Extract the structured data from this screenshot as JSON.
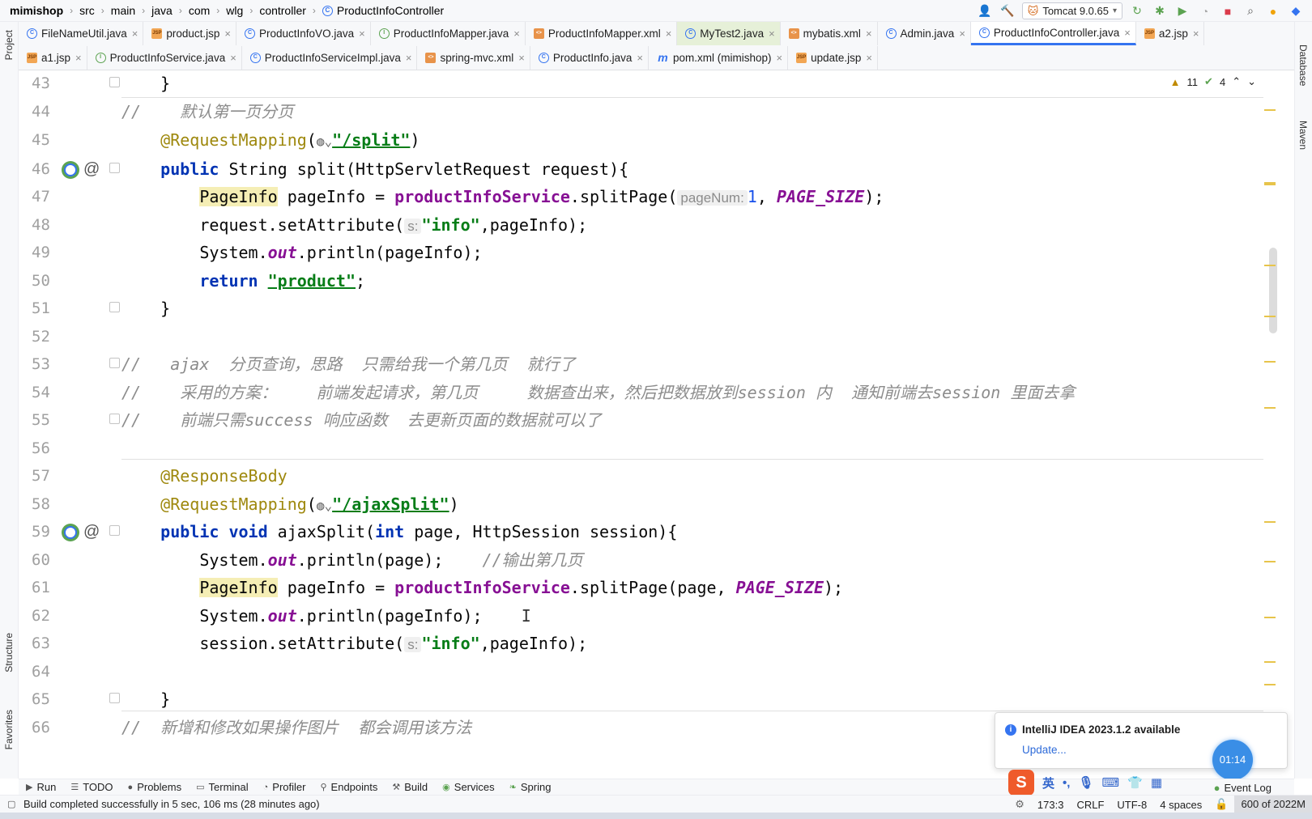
{
  "breadcrumb": [
    "mimishop",
    "src",
    "main",
    "java",
    "com",
    "wlg",
    "controller",
    "ProductInfoController"
  ],
  "run_config": "Tomcat 9.0.65",
  "tabs_row1": [
    {
      "name": "FileNameUtil.java",
      "icon": "c"
    },
    {
      "name": "product.jsp",
      "icon": "jsp"
    },
    {
      "name": "ProductInfoVO.java",
      "icon": "c"
    },
    {
      "name": "ProductInfoMapper.java",
      "icon": "i"
    },
    {
      "name": "ProductInfoMapper.xml",
      "icon": "xml"
    },
    {
      "name": "MyTest2.java",
      "icon": "c"
    },
    {
      "name": "mybatis.xml",
      "icon": "xml"
    },
    {
      "name": "Admin.java",
      "icon": "c"
    },
    {
      "name": "ProductInfoController.java",
      "icon": "c"
    },
    {
      "name": "a2.jsp",
      "icon": "jsp"
    }
  ],
  "tabs_row2": [
    {
      "name": "a1.jsp",
      "icon": "jsp"
    },
    {
      "name": "ProductInfoService.java",
      "icon": "i"
    },
    {
      "name": "ProductInfoServiceImpl.java",
      "icon": "c"
    },
    {
      "name": "spring-mvc.xml",
      "icon": "xml"
    },
    {
      "name": "ProductInfo.java",
      "icon": "c"
    },
    {
      "name": "pom.xml (mimishop)",
      "icon": "m"
    },
    {
      "name": "update.jsp",
      "icon": "jsp"
    }
  ],
  "side_tabs": {
    "project": "Project",
    "structure": "Structure",
    "favorites": "Favorites",
    "database": "Database",
    "maven": "Maven"
  },
  "inspections": {
    "warnings": "11",
    "ok": "4"
  },
  "code": {
    "l43": {
      "num": "43",
      "brace": "}"
    },
    "l44": {
      "num": "44",
      "comment": "//    默认第一页分页"
    },
    "l45": {
      "num": "45",
      "ann": "@RequestMapping",
      "path": "\"/split\""
    },
    "l46": {
      "num": "46",
      "kw": "public",
      "rest": " String split(HttpServletRequest request){"
    },
    "l47": {
      "num": "47",
      "type": "PageInfo",
      "mid": " pageInfo = ",
      "svc": "productInfoService",
      "call": ".splitPage(",
      "hint": "pageNum:",
      "n": "1",
      "sep": ", ",
      "fld": "PAGE_SIZE",
      "end": ");"
    },
    "l48": {
      "num": "48",
      "pre": "request.setAttribute(",
      "hint": "s:",
      "str": "\"info\"",
      "end": ",pageInfo);"
    },
    "l49": {
      "num": "49",
      "pre": "System.",
      "fld": "out",
      "end": ".println(pageInfo);"
    },
    "l50": {
      "num": "50",
      "kw": "return",
      "str": "\"product\"",
      "end": ";"
    },
    "l51": {
      "num": "51",
      "brace": "}"
    },
    "l52": {
      "num": "52"
    },
    "l53": {
      "num": "53",
      "comment": "//   ajax  分页查询，思路  只需给我一个第几页  就行了"
    },
    "l54": {
      "num": "54",
      "comment": "//    采用的方案：    前端发起请求，第几页     数据查出来，然后把数据放到session 内  通知前端去session 里面去拿"
    },
    "l55": {
      "num": "55",
      "comment": "//    前端只需success 响应函数  去更新页面的数据就可以了"
    },
    "l56": {
      "num": "56"
    },
    "l57": {
      "num": "57",
      "ann": "@ResponseBody"
    },
    "l58": {
      "num": "58",
      "ann": "@RequestMapping",
      "path": "\"/ajaxSplit\""
    },
    "l59": {
      "num": "59",
      "kw": "public",
      "kw2": "void",
      "mid": " ajaxSplit(",
      "kw3": "int",
      "rest": " page, HttpSession session){"
    },
    "l60": {
      "num": "60",
      "pre": "System.",
      "fld": "out",
      "end": ".println(page);",
      "comment": "    //输出第几页"
    },
    "l61": {
      "num": "61",
      "type": "PageInfo",
      "mid": " pageInfo = ",
      "svc": "productInfoService",
      "call": ".splitPage(page, ",
      "fld": "PAGE_SIZE",
      "end": ");"
    },
    "l62": {
      "num": "62",
      "pre": "System.",
      "fld": "out",
      "end": ".println(pageInfo);"
    },
    "l63": {
      "num": "63",
      "pre": "session.setAttribute(",
      "hint": "s:",
      "str": "\"info\"",
      "end": ",pageInfo);"
    },
    "l64": {
      "num": "64"
    },
    "l65": {
      "num": "65",
      "brace": "}"
    },
    "l66": {
      "num": "66",
      "comment": "//  新增和修改如果操作图片  都会调用该方法"
    }
  },
  "notification": {
    "title": "IntelliJ IDEA 2023.1.2 available",
    "link": "Update..."
  },
  "timer": "01:14",
  "tool_windows": [
    "Run",
    "TODO",
    "Problems",
    "Terminal",
    "Profiler",
    "Endpoints",
    "Build",
    "Services",
    "Spring"
  ],
  "ime": {
    "lang": "英",
    "punct": "•,"
  },
  "event_log": "Event Log",
  "status": {
    "message": "Build completed successfully in 5 sec, 106 ms (28 minutes ago)",
    "position": "173:3",
    "line_sep": "CRLF",
    "encoding": "UTF-8",
    "indent": "4 spaces",
    "memory": "600 of 2022M"
  }
}
